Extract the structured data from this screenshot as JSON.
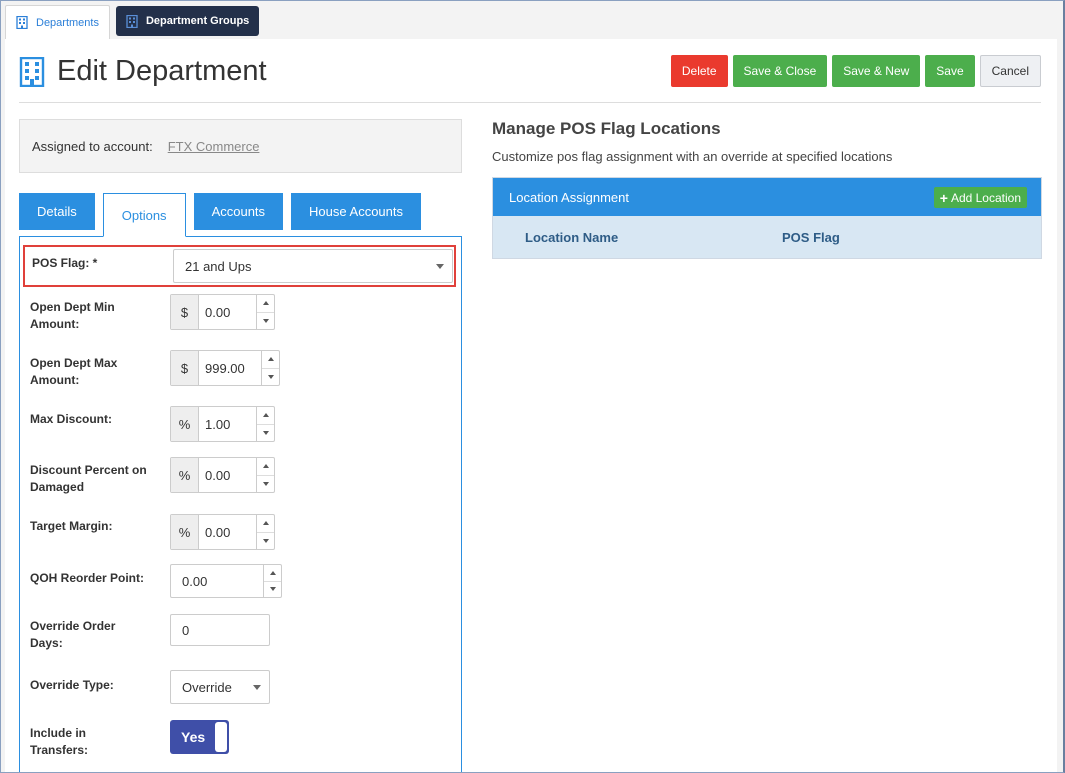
{
  "top_tabs": [
    {
      "label": "Departments"
    },
    {
      "label": "Department Groups"
    }
  ],
  "header": {
    "title": "Edit Department",
    "buttons": {
      "delete": "Delete",
      "save_close": "Save & Close",
      "save_new": "Save & New",
      "save": "Save",
      "cancel": "Cancel"
    }
  },
  "assigned": {
    "label": "Assigned to account:",
    "account": "FTX Commerce"
  },
  "inner_tabs": [
    "Details",
    "Options",
    "Accounts",
    "House Accounts"
  ],
  "form": {
    "pos_flag": {
      "label": "POS Flag: *",
      "value": "21 and Ups"
    },
    "open_min": {
      "label": "Open Dept Min Amount:",
      "addon": "$",
      "value": "0.00"
    },
    "open_max": {
      "label": "Open Dept Max Amount:",
      "addon": "$",
      "value": "999.00"
    },
    "max_discount": {
      "label": "Max Discount:",
      "addon": "%",
      "value": "1.00"
    },
    "discount_damaged": {
      "label": "Discount Percent on Damaged",
      "addon": "%",
      "value": "0.00"
    },
    "target_margin": {
      "label": "Target Margin:",
      "addon": "%",
      "value": "0.00"
    },
    "qoh_reorder": {
      "label": "QOH Reorder Point:",
      "value": "0.00"
    },
    "override_days": {
      "label": "Override Order Days:",
      "value": "0"
    },
    "override_type": {
      "label": "Override Type:",
      "value": "Override"
    },
    "include_transfers": {
      "label": "Include in Transfers:",
      "value": "Yes"
    }
  },
  "pos_locations": {
    "title": "Manage POS Flag Locations",
    "subtitle": "Customize pos flag assignment with an override at specified locations",
    "table_title": "Location Assignment",
    "add_button": "Add Location",
    "columns": [
      "Location Name",
      "POS Flag"
    ]
  },
  "colors": {
    "primary": "#2b8fe0",
    "danger": "#ea3a2e",
    "success": "#4cae4c",
    "toggle": "#3f4fa8",
    "highlight": "#e0403a"
  }
}
